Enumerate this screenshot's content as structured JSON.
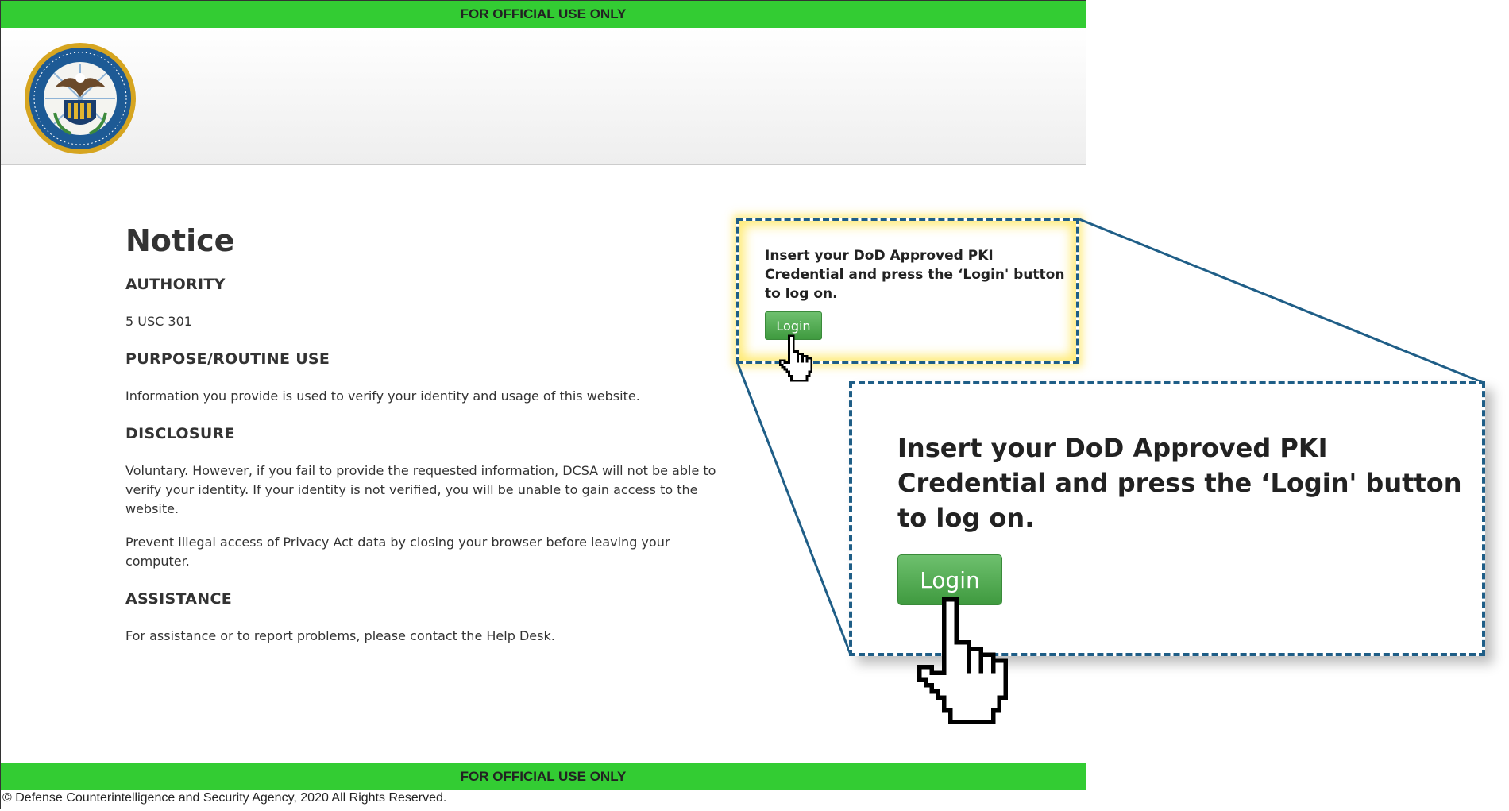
{
  "banner": {
    "top_text": "FOR OFFICIAL USE ONLY",
    "bottom_text": "FOR OFFICIAL USE ONLY"
  },
  "header": {
    "seal_text": "DEFENSE COUNTERINTELLIGENCE AND SECURITY AGENCY"
  },
  "notice": {
    "title": "Notice",
    "sections": [
      {
        "heading": "AUTHORITY",
        "paragraphs": [
          "5 USC 301"
        ]
      },
      {
        "heading": "PURPOSE/ROUTINE USE",
        "paragraphs": [
          "Information you provide is used to verify your identity and usage of this website."
        ]
      },
      {
        "heading": "DISCLOSURE",
        "paragraphs": [
          "Voluntary. However, if you fail to provide the requested information, DCSA will not be able to verify your identity. If your identity is not verified, you will be unable to gain access to the website.",
          "Prevent illegal access of Privacy Act data by closing your browser before leaving your computer."
        ]
      },
      {
        "heading": "ASSISTANCE",
        "paragraphs": [
          "For assistance or to report problems, please contact the Help Desk."
        ]
      }
    ]
  },
  "login": {
    "message": "Insert your DoD Approved PKI Credential and press the ‘Login' button to log on.",
    "button_label": "Login"
  },
  "zoom": {
    "message": "Insert your DoD Approved PKI Credential and press the ‘Login' button to log on.",
    "button_label": "Login"
  },
  "footer": {
    "copyright": "© Defense Counterintelligence and Security Agency, 2020 All Rights Reserved."
  },
  "colors": {
    "banner": "#33cc33",
    "accent_blue": "#1f5e87",
    "button_green": "#4cae4c"
  },
  "icons": [
    "dcsa-seal-icon",
    "hand-pointer-cursor-icon"
  ]
}
